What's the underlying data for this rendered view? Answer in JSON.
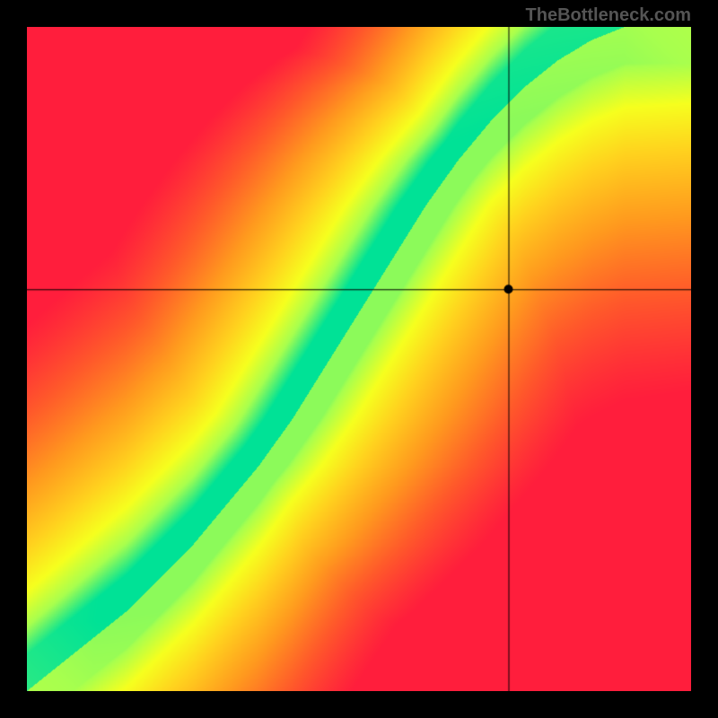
{
  "watermark": "TheBottleneck.com",
  "chart_data": {
    "type": "heatmap",
    "title": "",
    "xlabel": "",
    "ylabel": "",
    "xlim": [
      0,
      1
    ],
    "ylim": [
      0,
      1
    ],
    "ideal_curve_x": [
      0.0,
      0.05,
      0.1,
      0.15,
      0.2,
      0.25,
      0.3,
      0.35,
      0.4,
      0.45,
      0.5,
      0.55,
      0.6,
      0.65,
      0.7,
      0.75,
      0.8,
      0.85,
      0.9,
      0.95,
      1.0
    ],
    "ideal_curve_y": [
      0.0,
      0.04,
      0.08,
      0.12,
      0.17,
      0.22,
      0.28,
      0.34,
      0.41,
      0.49,
      0.57,
      0.65,
      0.73,
      0.8,
      0.86,
      0.91,
      0.95,
      0.98,
      1.0,
      1.0,
      1.0
    ],
    "band_halfwidth": 0.055,
    "colorscale": [
      {
        "t": 0.0,
        "color": "#ff1e3c"
      },
      {
        "t": 0.2,
        "color": "#ff5a2a"
      },
      {
        "t": 0.4,
        "color": "#ff9a1e"
      },
      {
        "t": 0.6,
        "color": "#ffd21e"
      },
      {
        "t": 0.75,
        "color": "#f6ff1e"
      },
      {
        "t": 0.88,
        "color": "#a8ff4e"
      },
      {
        "t": 1.0,
        "color": "#00e296"
      }
    ],
    "marker": {
      "x": 0.725,
      "y": 0.605
    },
    "crosshair": {
      "x": 0.725,
      "y": 0.605
    },
    "grid": false,
    "legend": null,
    "annotations": []
  }
}
